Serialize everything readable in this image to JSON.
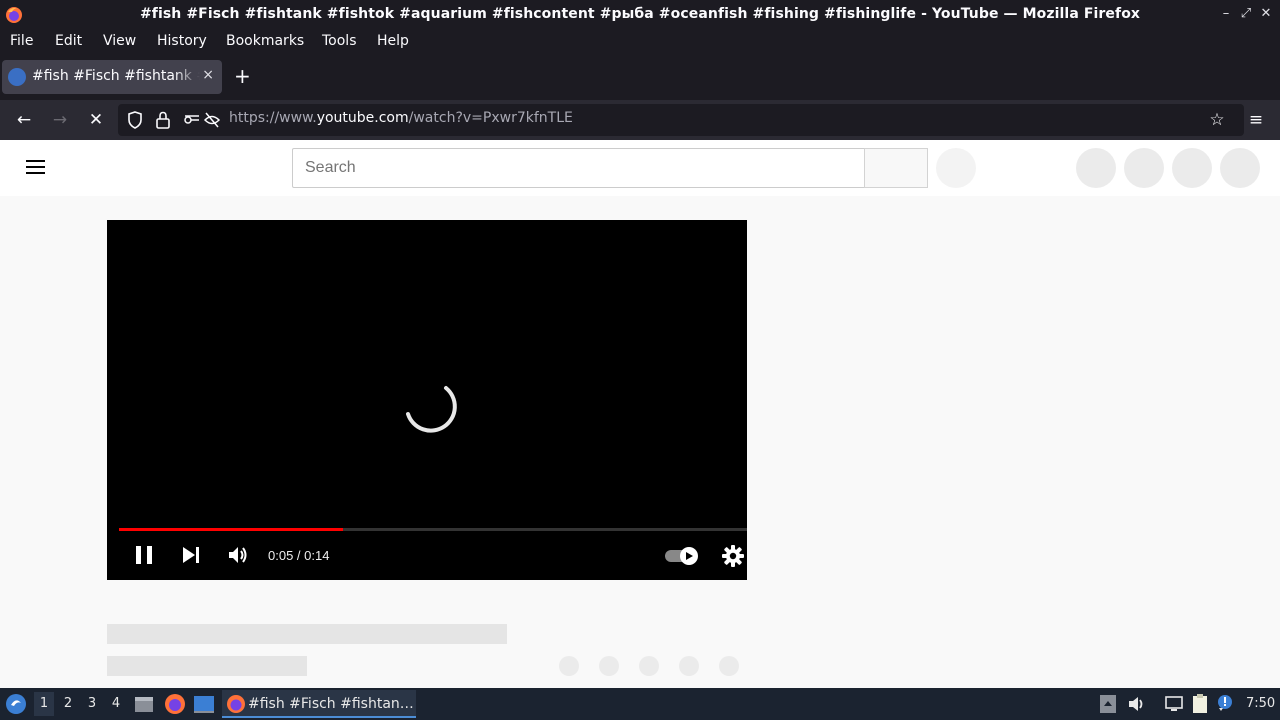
{
  "window": {
    "title": "#fish #Fisch #fishtank #fishtok #aquarium #fishcontent #рыба #oceanfish #fishing #fishinglife - YouTube — Mozilla Firefox"
  },
  "menu": {
    "file": "File",
    "edit": "Edit",
    "view": "View",
    "history": "History",
    "bookmarks": "Bookmarks",
    "tools": "Tools",
    "help": "Help"
  },
  "tab": {
    "title": "#fish #Fisch #fishtank #fishtok",
    "close": "×",
    "new_tab": "+"
  },
  "navbar": {
    "url_prefix": "https://www.",
    "url_host": "youtube.com",
    "url_path": "/watch?v=Pxwr7kfnTLE"
  },
  "youtube": {
    "search_placeholder": "Search"
  },
  "player": {
    "time_display": "0:05 / 0:14",
    "progress_fraction": 0.357
  },
  "taskbar": {
    "workspaces": [
      "1",
      "2",
      "3",
      "4"
    ],
    "active_workspace": "1",
    "task_title": "#fish #Fisch #fishtan…",
    "clock": "7:50"
  },
  "colors": {
    "firefox_chrome": "#1c1b22",
    "youtube_red": "#ff0000",
    "taskbar": "#1b2330"
  }
}
